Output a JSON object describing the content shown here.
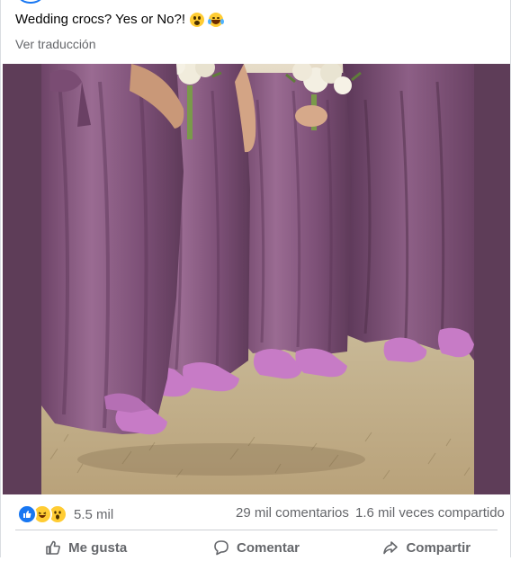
{
  "post": {
    "text": "Wedding crocs? Yes or No?!",
    "emojis": [
      "grimacing-face-icon",
      "crying-laughing-face-icon"
    ],
    "see_translation": "Ver traducción"
  },
  "image": {
    "description_icon": "bridesmaids-in-purple-dresses-with-crocs"
  },
  "stats": {
    "reaction_icons": [
      "like-reaction-icon",
      "haha-reaction-icon",
      "wow-reaction-icon"
    ],
    "reactions_count": "5.5 mil",
    "comments": "29 mil comentarios",
    "shares": "1.6 mil veces compartido"
  },
  "actions": {
    "like": "Me gusta",
    "comment": "Comentar",
    "share": "Compartir"
  },
  "colors": {
    "brand_blue": "#1877f2",
    "secondary_text": "#65676b",
    "dress_mauve": "#8a5c84",
    "croc_pink": "#c77bc6"
  }
}
